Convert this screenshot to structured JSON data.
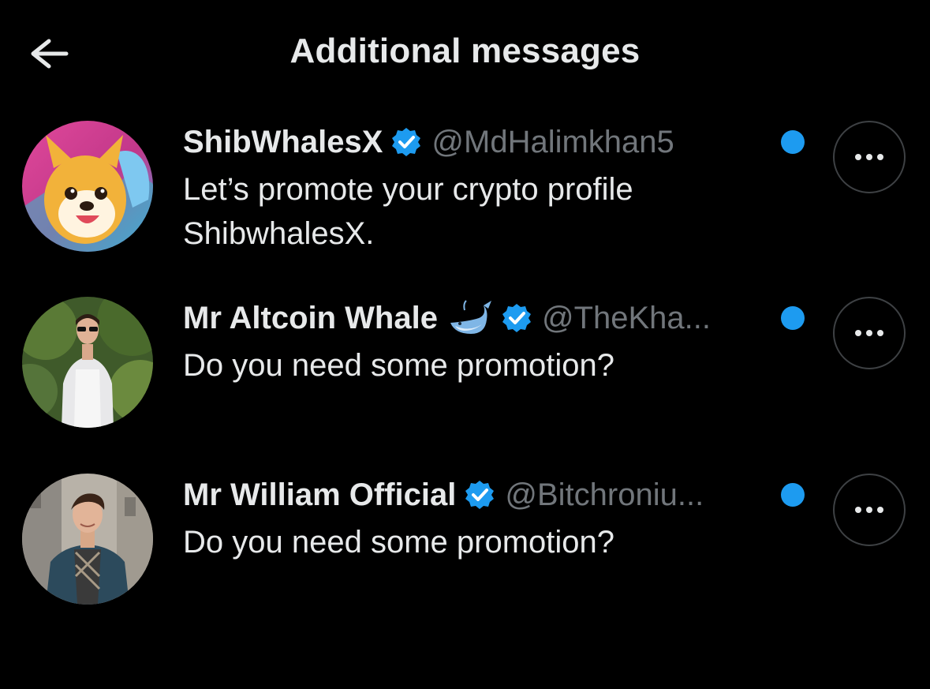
{
  "header": {
    "title": "Additional messages",
    "back_icon": "arrow-left-icon"
  },
  "colors": {
    "background": "#000000",
    "primary_text": "#e7e9ea",
    "secondary_text": "#71767b",
    "accent": "#1d9bf0"
  },
  "conversations": [
    {
      "name": "ShibWhalesX",
      "verified": true,
      "handle": "@MdHalimkhan5",
      "message": "Let’s promote your crypto profile ShibwhalesX.",
      "unread": true,
      "avatar": "shiba-cartoon-avatar"
    },
    {
      "name": "Mr Altcoin Whale",
      "emoji": "whale-emoji",
      "verified": true,
      "handle": "@TheKha...",
      "message": "Do you need some promotion?",
      "unread": true,
      "avatar": "man-photo-avatar"
    },
    {
      "name": "Mr William Official",
      "verified": true,
      "handle": "@Bitchroniu...",
      "message": "Do you need some promotion?",
      "unread": true,
      "avatar": "man-scarf-photo-avatar"
    }
  ]
}
